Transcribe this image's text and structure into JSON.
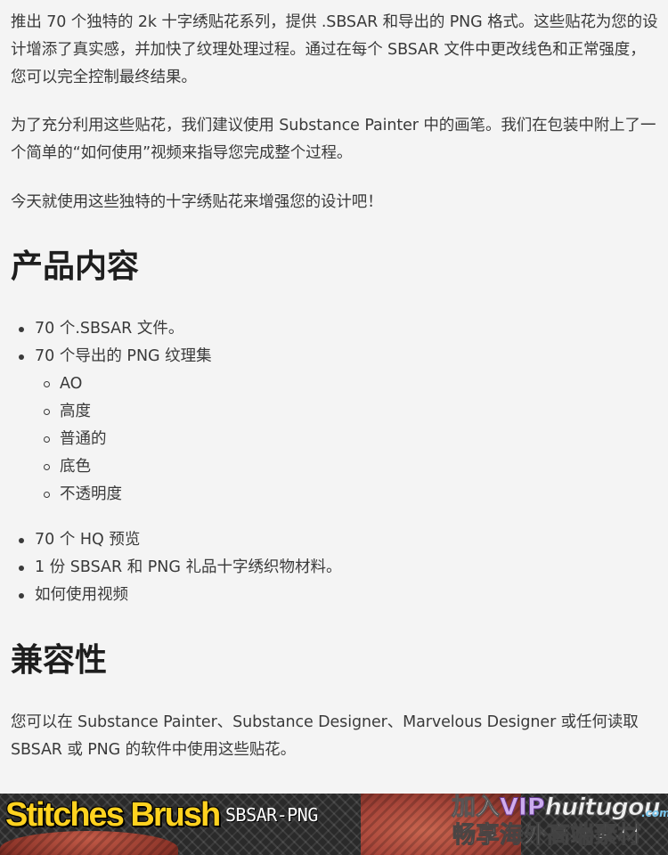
{
  "paragraphs": {
    "intro": "推出 70 个独特的 2k 十字绣贴花系列，提供 .SBSAR 和导出的 PNG 格式。这些贴花为您的设计增添了真实感，并加快了纹理处理过程。通过在每个 SBSAR 文件中更改线色和正常强度，您可以完全控制最终结果。",
    "tip": "为了充分利用这些贴花，我们建议使用 Substance Painter 中的画笔。我们在包装中附上了一个简单的“如何使用”视频来指导您完成整个过程。",
    "cta": "今天就使用这些独特的十字绣贴花来增强您的设计吧！"
  },
  "contents": {
    "heading": "产品内容",
    "items": [
      "70 个.SBSAR 文件。",
      "70 个导出的 PNG 纹理集"
    ],
    "subitems": [
      "AO",
      "高度",
      "普通的",
      "底色",
      "不透明度"
    ],
    "more_items": [
      "70 个 HQ 预览",
      "1 份 SBSAR 和 PNG 礼品十字绣织物材料。",
      "如何使用视频"
    ]
  },
  "compat": {
    "heading": "兼容性",
    "text": "您可以在 Substance Painter、Substance Designer、Marvelous Designer 或任何读取 SBSAR 或 PNG 的软件中使用这些贴花。"
  },
  "banner": {
    "title": "Stitches Brush",
    "subtitle": "SBSAR-PNG",
    "watermark_join": "加入",
    "watermark_vip": "VIP",
    "watermark_site": "huitugou",
    "watermark_domain": ".com",
    "watermark_slogan": "畅享海外高端素材",
    "title_color": "#ffd21f"
  }
}
